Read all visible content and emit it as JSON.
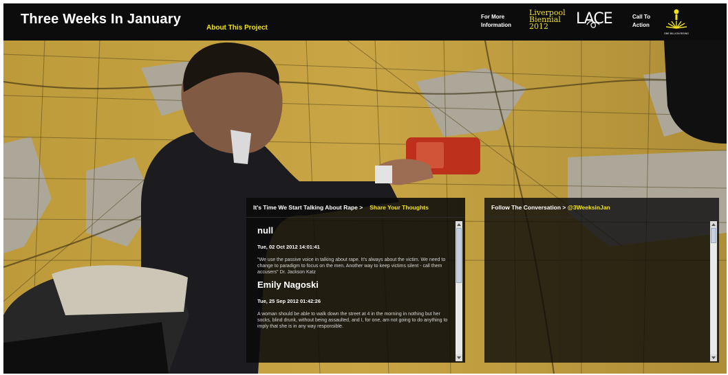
{
  "header": {
    "title": "Three Weeks In January",
    "about_link": "About This Project",
    "more_info_link": "For More Information",
    "biennial_logo": [
      "Liverpool",
      "Biennial",
      "2012"
    ],
    "lace_logo": "LACE",
    "call_to_action_link": "Call To Action",
    "obr_logo": "ONE BILLION RISING"
  },
  "left_panel": {
    "heading": "It's Time We Start Talking About Rape >",
    "share_link": "Share Your Thoughts",
    "posts": [
      {
        "author": "null",
        "date": "Tue, 02 Oct 2012 14:01:41",
        "text": "\"We use the passive voice in talking about rape. It's always about the victim. We need to change to paradigm to focus on the men. Another way to keep victims silent - call them accusers\" Dr. Jackson Katz"
      },
      {
        "author": "Emily Nagoski",
        "date": "Tue, 25 Sep 2012 01:42:26",
        "text": "A woman should be able to walk down the street at 4 in the morning in nothing but her socks, blind drunk, without being assaulted, and I, for one, am not going to do anything to imply that she is in any way responsible."
      }
    ]
  },
  "right_panel": {
    "heading": "Follow The Conversation >",
    "handle": "@3WeeksinJan"
  },
  "colors": {
    "accent": "#f1e21e",
    "topbar": "#0c0c0c",
    "panel": "#0a0a0a"
  }
}
